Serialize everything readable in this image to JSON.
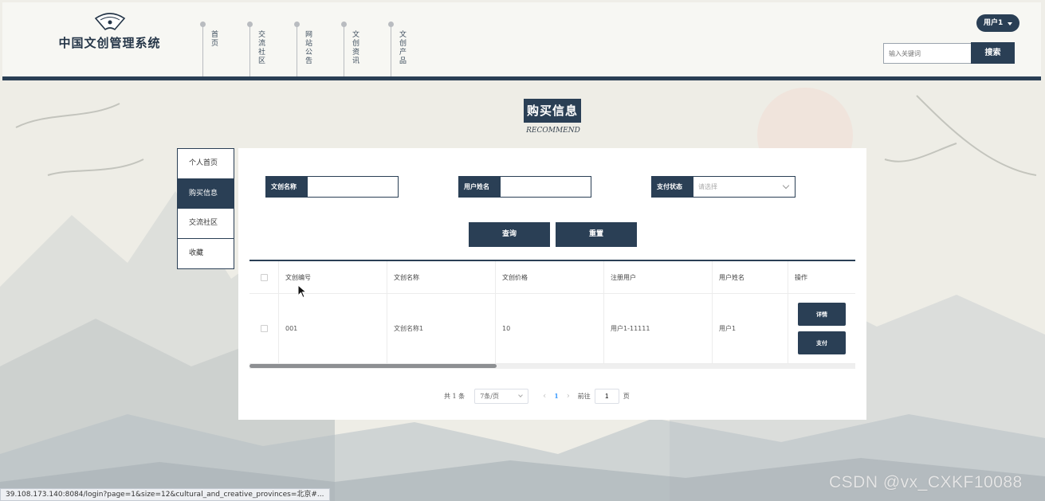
{
  "header": {
    "logo_title": "中国文创管理系统",
    "nav": [
      {
        "label": "首页"
      },
      {
        "label": "交流社区"
      },
      {
        "label": "网站公告"
      },
      {
        "label": "文创资讯"
      },
      {
        "label": "文创产品"
      }
    ],
    "user_label": "用户1",
    "search_placeholder": "输入关键词",
    "search_button": "搜索"
  },
  "page": {
    "title": "购买信息",
    "subtitle": "RECOMMEND"
  },
  "sidebar": {
    "items": [
      {
        "label": "个人首页",
        "active": false
      },
      {
        "label": "购买信息",
        "active": true
      },
      {
        "label": "交流社区",
        "active": false
      },
      {
        "label": "收藏",
        "active": false
      }
    ]
  },
  "filters": {
    "name_label": "文创名称",
    "name_value": "",
    "user_label": "用户姓名",
    "user_value": "",
    "status_label": "支付状态",
    "status_placeholder": "请选择",
    "query_button": "查询",
    "reset_button": "重置"
  },
  "table": {
    "columns": [
      "文创编号",
      "文创名称",
      "文创价格",
      "注册用户",
      "用户姓名",
      "操作"
    ],
    "rows": [
      {
        "code": "001",
        "name": "文创名称1",
        "price": "10",
        "account": "用户1-11111",
        "user": "用户1",
        "actions": [
          "详情",
          "支付"
        ]
      }
    ]
  },
  "pagination": {
    "total": "共 1 条",
    "page_size": "7条/页",
    "prev": "‹",
    "current": "1",
    "next": "›",
    "goto_label": "前往",
    "goto_value": "1",
    "page_unit": "页"
  },
  "status_bar": {
    "url": "39.108.173.140:8084/login?page=1&size=12&cultural_and_creative_provinces=北京#..."
  },
  "watermark": "CSDN @vx_CXKF10088",
  "colors": {
    "primary": "#2a3f55",
    "background": "#efeee8",
    "link": "#409eff"
  }
}
